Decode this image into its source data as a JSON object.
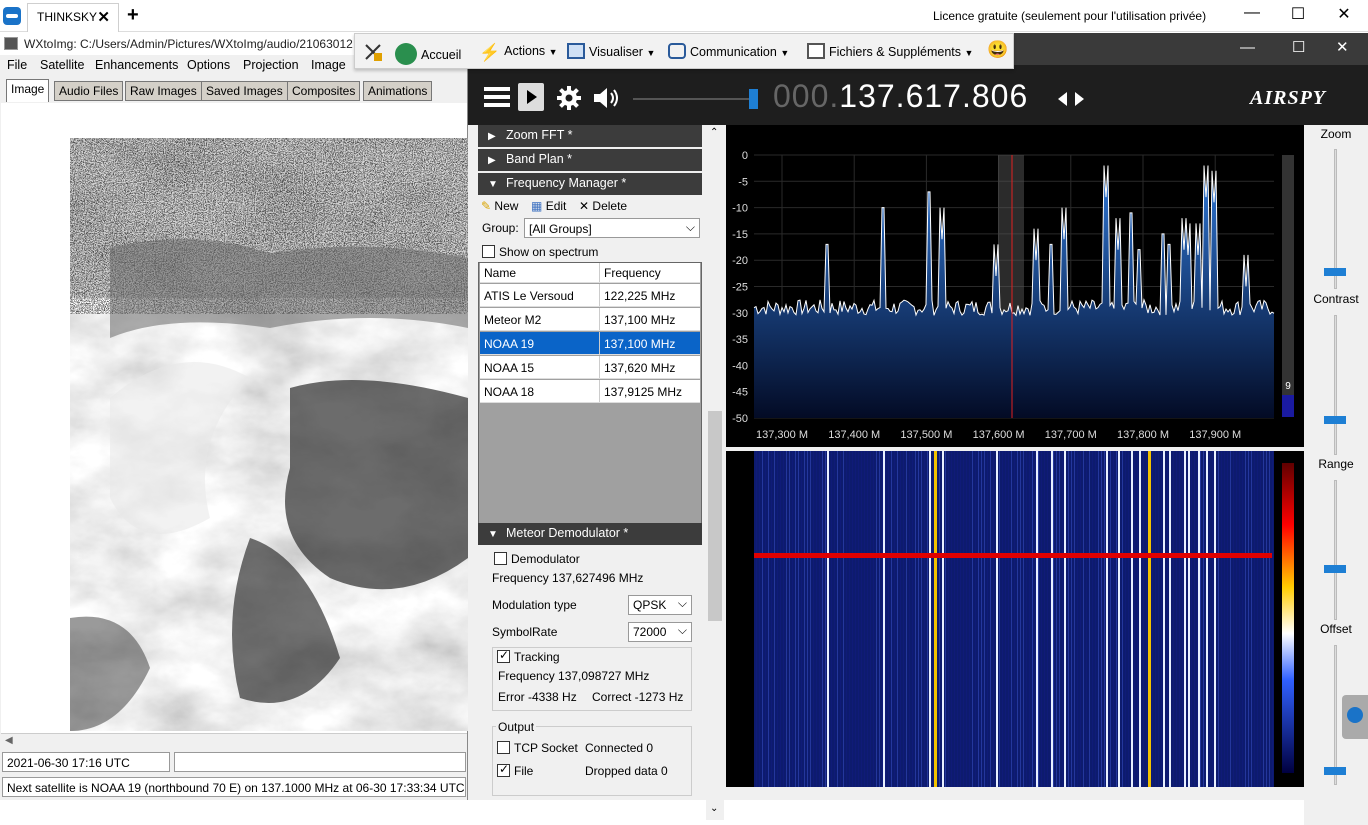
{
  "teamviewer": {
    "tab_label": "THINKSKY",
    "tab_close": "✕",
    "add_tab": "+",
    "licence_text": "Licence gratuite (seulement pour l'utilisation privée)",
    "minimize": "—",
    "maximize": "☐",
    "close": "✕",
    "toolbar": {
      "home": "Accueil",
      "actions": "Actions",
      "view": "Visualiser",
      "communication": "Communication",
      "files": "Fichiers & Suppléments",
      "emoji": "😃"
    }
  },
  "wxtoimg": {
    "title": "WXtoImg: C:/Users/Admin/Pictures/WXtoImg/audio/21063012",
    "menu": [
      "File",
      "Satellite",
      "Enhancements",
      "Options",
      "Projection",
      "Image",
      "Help"
    ],
    "tabs": [
      "Image",
      "Audio Files",
      "Raw Images",
      "Saved Images",
      "Composites",
      "Animations"
    ],
    "active_tab": "Image",
    "status_time": "2021-06-30  17:16 UTC",
    "status_next": "Next satellite is NOAA 19 (northbound 70 E) on 137.1000 MHz at 06-30 17:33:34 UTC"
  },
  "sdr": {
    "frequency_dim": "000.",
    "frequency": "137.617.806",
    "logo": "AIRSPY",
    "min": "—",
    "max": "☐",
    "close": "✕",
    "sections": {
      "zoom_fft": "Zoom FFT *",
      "band_plan": "Band Plan *",
      "freq_manager": "Frequency Manager *",
      "meteor_demod": "Meteor Demodulator *"
    },
    "fm_toolbar": {
      "new": "New",
      "edit": "Edit",
      "delete": "Delete"
    },
    "group_label": "Group:",
    "group_value": "[All Groups]",
    "show_on_spectrum": "Show on spectrum",
    "table_headers": [
      "Name",
      "Frequency"
    ],
    "table_rows": [
      {
        "name": "ATIS Le Versoud",
        "freq": "122,225 MHz"
      },
      {
        "name": "Meteor M2",
        "freq": "137,100 MHz"
      },
      {
        "name": "NOAA 19",
        "freq": "137,100 MHz"
      },
      {
        "name": "NOAA 15",
        "freq": "137,620 MHz"
      },
      {
        "name": "NOAA 18",
        "freq": "137,9125 MHz"
      }
    ],
    "selected_row": 2,
    "demod": {
      "demodulator": "Demodulator",
      "frequency": "Frequency 137,627496 MHz",
      "modulation_label": "Modulation type",
      "modulation_value": "QPSK",
      "symbolrate_label": "SymbolRate",
      "symbolrate_value": "72000",
      "tracking": "Tracking",
      "tracking_freq": "Frequency 137,098727 MHz",
      "error": "Error -4338 Hz",
      "correct": "Correct -1273 Hz",
      "output": "Output",
      "tcp": "TCP Socket",
      "connected": "Connected 0",
      "file": "File",
      "dropped": "Dropped data 0"
    },
    "spectrum": {
      "y_ticks": [
        "0",
        "-5",
        "-10",
        "-15",
        "-20",
        "-25",
        "-30",
        "-35",
        "-40",
        "-45",
        "-50"
      ],
      "x_ticks": [
        "137,300 M",
        "137,400 M",
        "137,500 M",
        "137,600 M",
        "137,700 M",
        "137,800 M",
        "137,900 M"
      ],
      "level_badge": "9"
    },
    "controls": {
      "zoom": "Zoom",
      "contrast": "Contrast",
      "range": "Range",
      "offset": "Offset"
    }
  }
}
